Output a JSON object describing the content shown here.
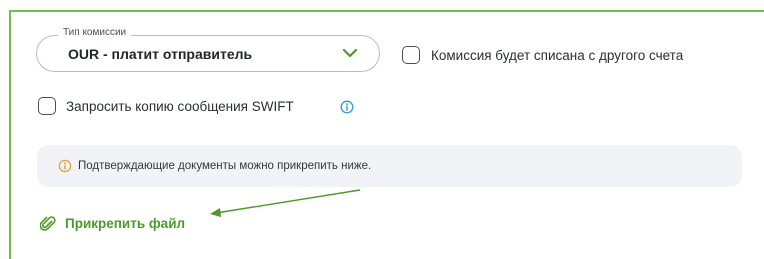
{
  "commission": {
    "legend": "Тип комиссии",
    "selected": "OUR - платит отправитель",
    "icon": "chevron-down-icon"
  },
  "other_account_checkbox": {
    "label": "Комиссия будет списана с другого счета",
    "checked": false
  },
  "swift_checkbox": {
    "label": "Запросить копию сообщения SWIFT",
    "checked": false,
    "info_icon": "info-icon"
  },
  "notice": {
    "icon": "info-icon",
    "text": "Подтверждающие документы можно прикрепить ниже."
  },
  "attach": {
    "icon": "paperclip-icon",
    "label": "Прикрепить файл"
  },
  "colors": {
    "accent_green": "#4c9a2a",
    "border_green": "#6fbf4b",
    "info_blue": "#2f9bd6",
    "notice_bg": "#f1f3f6"
  }
}
